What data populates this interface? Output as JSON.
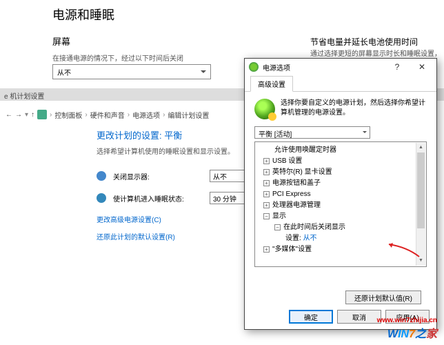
{
  "header": {
    "title": "电源和睡眠",
    "section": "屏幕",
    "screen_label": "在接通电源的情况下，经过以下时间后关闭",
    "screen_value": "从不",
    "tip_title": "节省电量并延长电池使用时间",
    "tip_body": "通过选择更短的屏幕显示时长和睡眠设置，延长电池使用时间。"
  },
  "band": "e 机计划设置",
  "breadcrumb": {
    "up": "↑",
    "items": [
      "控制面板",
      "硬件和声音",
      "电源选项",
      "编辑计划设置"
    ]
  },
  "plan": {
    "title": "更改计划的设置: 平衡",
    "subtitle": "选择希望计算机使用的睡眠设置和显示设置。",
    "row1_label": "关闭显示器:",
    "row1_value": "从不",
    "row2_label": "使计算机进入睡眠状态:",
    "row2_value": "30 分钟",
    "link1": "更改高级电源设置(C)",
    "link2": "还原此计划的默认设置(R)"
  },
  "dialog": {
    "title": "电源选项",
    "help": "?",
    "close": "✕",
    "tab": "高级设置",
    "intro": "选择你要自定义的电源计划，然后选择你希望计算机管理的电源设置。",
    "plan_dd": "平衡 [活动]",
    "tree": {
      "n0": "允许使用唤醒定时器",
      "n1": "USB 设置",
      "n2": "英特尔(R) 显卡设置",
      "n3": "电源按钮和盖子",
      "n4": "PCI Express",
      "n5": "处理器电源管理",
      "n6": "显示",
      "n6a": "在此时间后关闭显示",
      "n6a_set": "设置:",
      "n6a_val": "从不",
      "n7": "\"多媒体\"设置"
    },
    "restore": "还原计划默认值(R)",
    "ok": "确定",
    "cancel": "取消",
    "apply": "应用(A)"
  },
  "watermark": {
    "url": "www.win7zhijia.cn",
    "logo": {
      "w": "W",
      "i": "IN",
      "n": "7",
      "z": "之",
      "j": "家"
    }
  }
}
